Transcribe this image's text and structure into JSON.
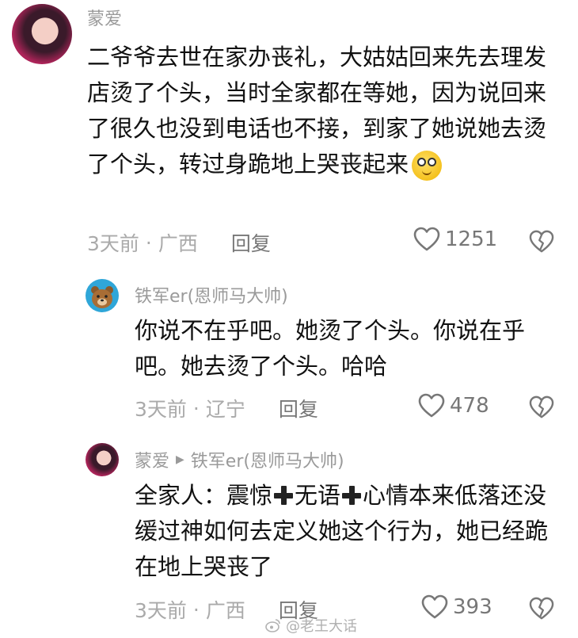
{
  "comment": {
    "username": "蒙爱",
    "body": "二爷爷去世在家办丧礼，大姑姑回来先去理发店烫了个头，当时全家都在等她，因为说回来了很久也没到电话也不接，到家了她说她去烫了个头，转过身跪地上哭丧起来",
    "time": "3天前",
    "location": "广西",
    "reply_label": "回复",
    "likes": "1251",
    "emoji_icon": "dizzy-face-emoji"
  },
  "replies": [
    {
      "username": "铁军er",
      "tag": "(恩师马大帅)",
      "body": "你说不在乎吧。她烫了个头。你说在乎吧。她去烫了个头。哈哈",
      "time": "3天前",
      "location": "辽宁",
      "reply_label": "回复",
      "likes": "478"
    },
    {
      "username": "蒙爱",
      "reply_to": "铁军er",
      "reply_to_tag": "(恩师马大帅)",
      "body_part1": "全家人：震惊",
      "body_part2": "无语",
      "body_part3": "心情本来低落还没缓过神如何去定义她这个行为，她已经跪在地上哭丧了",
      "time": "3天前",
      "location": "广西",
      "reply_label": "回复",
      "likes": "393"
    }
  ],
  "separator": "·",
  "watermark": "@老王大话",
  "colors": {
    "username": "#9a9a9a",
    "body": "#111111",
    "meta": "#aaaaaa",
    "icon": "#777777"
  }
}
